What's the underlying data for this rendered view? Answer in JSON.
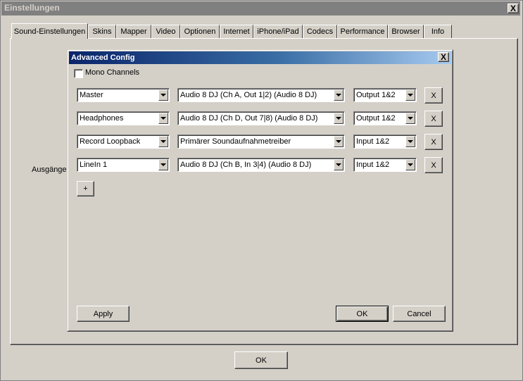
{
  "main_window": {
    "title": "Einstellungen",
    "close_label": "X",
    "tabs": [
      {
        "label": "Sound-Einstellungen"
      },
      {
        "label": "Skins"
      },
      {
        "label": "Mapper"
      },
      {
        "label": "Video"
      },
      {
        "label": "Optionen"
      },
      {
        "label": "Internet"
      },
      {
        "label": "iPhone/iPad"
      },
      {
        "label": "Codecs"
      },
      {
        "label": "Performance"
      },
      {
        "label": "Browser"
      },
      {
        "label": "Info"
      }
    ],
    "outputs_label": "Ausgänge",
    "ok_label": "OK"
  },
  "dialog": {
    "title": "Advanced Config",
    "close_label": "X",
    "mono_channels_label": "Mono Channels",
    "mono_channels_checked": false,
    "rows": [
      {
        "name": "Master",
        "device": "Audio 8 DJ (Ch A, Out 1|2) (Audio 8 DJ)",
        "channels": "Output 1&2",
        "remove_label": "X"
      },
      {
        "name": "Headphones",
        "device": "Audio 8 DJ (Ch D, Out 7|8) (Audio 8 DJ)",
        "channels": "Output 1&2",
        "remove_label": "X"
      },
      {
        "name": "Record Loopback",
        "device": "Primärer Soundaufnahmetreiber",
        "channels": "Input 1&2",
        "remove_label": "X"
      },
      {
        "name": "LineIn 1",
        "device": "Audio 8 DJ (Ch B, In 3|4) (Audio 8 DJ)",
        "channels": "Input 1&2",
        "remove_label": "X"
      }
    ],
    "add_label": "+",
    "apply_label": "Apply",
    "ok_label": "OK",
    "cancel_label": "Cancel"
  }
}
